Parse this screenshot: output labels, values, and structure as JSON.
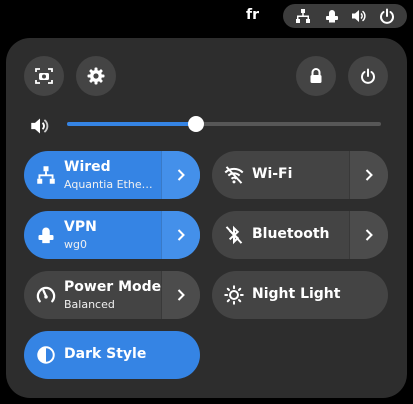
{
  "topbar": {
    "language": "fr",
    "tray_icons": [
      "network-wired-icon",
      "vpn-icon",
      "volume-icon",
      "power-icon"
    ]
  },
  "panel": {
    "top_buttons": [
      "screenshot-icon",
      "settings-icon",
      "lock-icon",
      "power-icon"
    ],
    "volume": {
      "icon": "volume-icon",
      "level": 0.41
    },
    "tiles": {
      "wired": {
        "title": "Wired",
        "subtitle": "Aquantia Ethernet",
        "state": "on"
      },
      "wifi": {
        "title": "Wi-Fi",
        "state": "off"
      },
      "vpn": {
        "title": "VPN",
        "subtitle": "wg0",
        "state": "on"
      },
      "bluetooth": {
        "title": "Bluetooth",
        "state": "off"
      },
      "power_mode": {
        "title": "Power Mode",
        "subtitle": "Balanced",
        "state": "off"
      },
      "night_light": {
        "title": "Night Light",
        "state": "off"
      },
      "dark_style": {
        "title": "Dark Style",
        "state": "on"
      }
    }
  },
  "colors": {
    "accent": "#3584e4",
    "panel": "#2d2d2d",
    "tile": "#444444",
    "background": "#000000"
  }
}
